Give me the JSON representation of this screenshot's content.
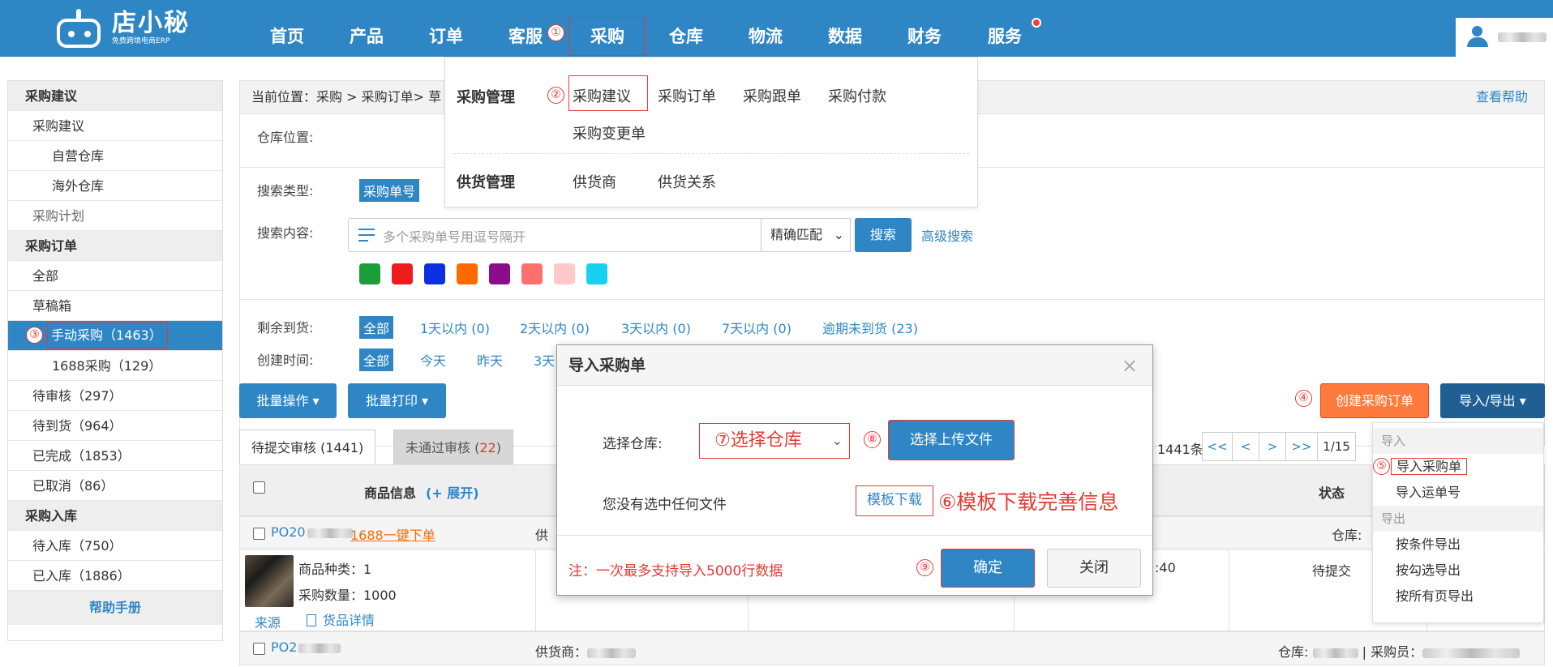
{
  "brand": {
    "name": "店小秘",
    "subtitle": "免费跨境电商ERP"
  },
  "nav": {
    "items": [
      "首页",
      "产品",
      "订单",
      "客服",
      "仓库",
      "物流",
      "数据",
      "财务",
      "服务"
    ],
    "active": "采购",
    "active_step": "①"
  },
  "sidebar": {
    "sections": [
      {
        "title": "采购建议",
        "items": [
          {
            "label": "采购建议",
            "level": 1
          },
          {
            "label": "自营仓库",
            "level": 2
          },
          {
            "label": "海外仓库",
            "level": 2
          },
          {
            "label": "采购计划",
            "level": 1
          }
        ]
      },
      {
        "title": "采购订单",
        "items": [
          {
            "label": "全部",
            "level": 1
          },
          {
            "label": "草稿箱",
            "level": 1
          },
          {
            "label": "手动采购（1463）",
            "level": 2,
            "active": true,
            "step": "③"
          },
          {
            "label": "1688采购（129）",
            "level": 2
          },
          {
            "label": "待审核（297）",
            "level": 1
          },
          {
            "label": "待到货（964）",
            "level": 1
          },
          {
            "label": "已完成（1853）",
            "level": 1
          },
          {
            "label": "已取消（86）",
            "level": 1
          }
        ]
      },
      {
        "title": "采购入库",
        "items": [
          {
            "label": "待入库（750）",
            "level": 1
          },
          {
            "label": "已入库（1886）",
            "level": 1
          }
        ]
      }
    ],
    "help": "帮助手册"
  },
  "breadcrumb": {
    "text": "当前位置：采购 > 采购订单> 草",
    "help": "查看帮助"
  },
  "dropdown": {
    "purchase_mgmt": "采购管理",
    "step": "②",
    "items_row1": [
      "采购建议",
      "采购订单",
      "采购跟单",
      "采购付款"
    ],
    "items_row2": [
      "采购变更单"
    ],
    "supply_mgmt": "供货管理",
    "supply_items": [
      "供货商",
      "供货关系"
    ]
  },
  "filters": {
    "warehouse_label": "仓库位置:",
    "search_type_label": "搜索类型:",
    "search_type_value": "采购单号",
    "search_content_label": "搜索内容:",
    "search_placeholder": "多个采购单号用逗号隔开",
    "match_mode": "精确匹配",
    "search_button": "搜索",
    "advanced": "高级搜索",
    "colors": [
      "#1a9e3a",
      "#ee1c1c",
      "#0d2fe0",
      "#ff6a00",
      "#8b0c8c",
      "#ff6f6f",
      "#ffc9c9",
      "#16d2f0"
    ],
    "remaining_label": "剩余到货:",
    "remaining_options": [
      "全部",
      "1天以内 (0)",
      "2天以内 (0)",
      "3天以内 (0)",
      "7天以内 (0)",
      "逾期未到货 (23)"
    ],
    "created_label": "创建时间:",
    "created_options": [
      "全部",
      "今天",
      "昨天",
      "3天"
    ]
  },
  "toolbar": {
    "batch_ops": "批量操作 ▾",
    "batch_print": "批量打印 ▾",
    "step4": "④",
    "create_order": "创建采购订单",
    "import_export": "导入/导出 ▾"
  },
  "tabs": {
    "pending": "待提交审核 (1441)",
    "rejected_prefix": "未通过审核 (",
    "rejected_count": "22",
    "rejected_suffix": ")"
  },
  "pager": {
    "total": "1441条",
    "buttons": [
      "<<",
      "<",
      ">",
      ">>",
      "1/15"
    ]
  },
  "table": {
    "col_product": "商品信息",
    "expand": "(+ 展开)",
    "col_status": "状态",
    "row1": {
      "po_prefix": "PO20",
      "tag": "1688一键下单",
      "supplier_label": "供",
      "warehouse_label": "仓库:",
      "sku_kinds": "商品种类：1",
      "qty": "采购数量：1000",
      "source": "来源",
      "detail": "货品详情",
      "time_fragment": ":40",
      "status": "待提交"
    },
    "row2": {
      "po_prefix": "PO2",
      "supplier_label": "供货商：",
      "warehouse_label": "仓库:",
      "buyer_label": "| 采购员："
    }
  },
  "io_menu": {
    "import_group": "导入",
    "step5": "⑤",
    "import_order": "导入采购单",
    "import_waybill": "导入运单号",
    "export_group": "导出",
    "export_items": [
      "按条件导出",
      "按勾选导出",
      "按所有页导出"
    ]
  },
  "modal": {
    "title": "导入采购单",
    "close": "×",
    "warehouse_label": "选择仓库:",
    "warehouse_select": "⑦选择仓库",
    "step8": "⑧",
    "upload_button": "选择上传文件",
    "no_file": "您没有选中任何文件",
    "template_link": "模板下载",
    "template_note": "⑥模板下载完善信息",
    "note": "注：一次最多支持导入5000行数据",
    "step9": "⑨",
    "ok": "确定",
    "cancel": "关闭"
  }
}
